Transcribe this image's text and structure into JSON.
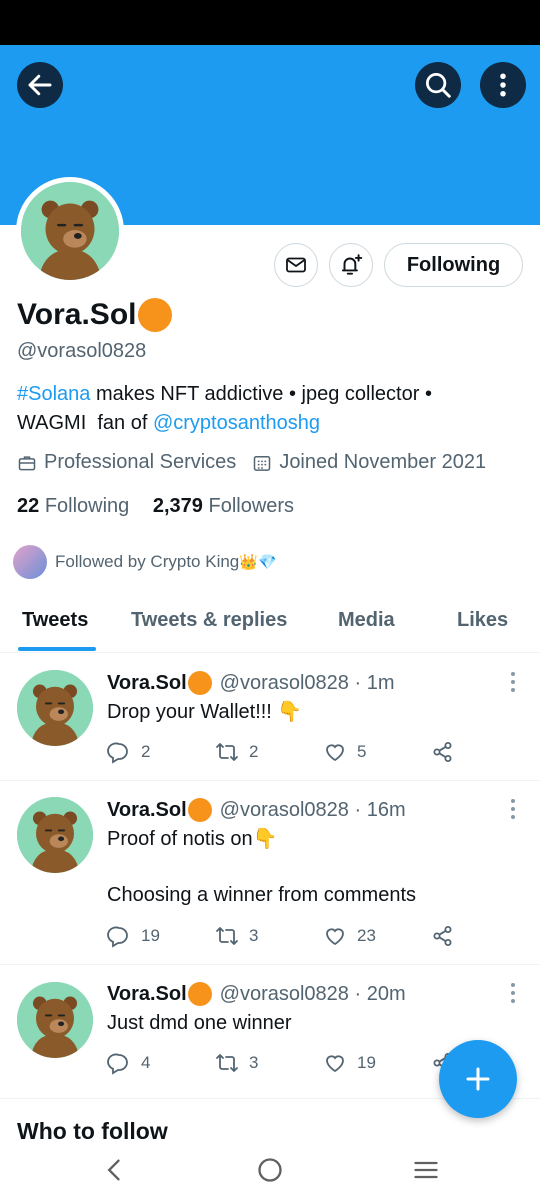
{
  "banner": {
    "color": "#1d9bf0"
  },
  "profile": {
    "display_name": "Vora.Sol",
    "handle": "@vorasol0828",
    "bio_hashtag": "#Solana",
    "bio_text_1": " makes NFT addictive • jpeg collector •",
    "bio_text_2": "WAGMI  fan of ",
    "bio_mention": "@cryptosanthoshg",
    "category": "Professional Services",
    "joined": "Joined November 2021",
    "following_count": "22",
    "following_label": "Following",
    "followers_count": "2,379",
    "followers_label": "Followers",
    "followed_by": "Followed by Crypto King",
    "followed_by_emoji": "👑💎"
  },
  "actions": {
    "follow_button": "Following"
  },
  "tabs": [
    {
      "label": "Tweets",
      "active": true
    },
    {
      "label": "Tweets & replies",
      "active": false
    },
    {
      "label": "Media",
      "active": false
    },
    {
      "label": "Likes",
      "active": false
    }
  ],
  "tweets": [
    {
      "name": "Vora.Sol",
      "handle": "@vorasol0828",
      "time": "· 1m",
      "text": "Drop your Wallet!!! 👇",
      "replies": "2",
      "retweets": "2",
      "likes": "5"
    },
    {
      "name": "Vora.Sol",
      "handle": "@vorasol0828",
      "time": "· 16m",
      "text": "Proof of notis on👇\n\nChoosing a winner from comments",
      "replies": "19",
      "retweets": "3",
      "likes": "23"
    },
    {
      "name": "Vora.Sol",
      "handle": "@vorasol0828",
      "time": "· 20m",
      "text": "Just dmd one winner",
      "replies": "4",
      "retweets": "3",
      "likes": "19"
    }
  ],
  "section": {
    "who_to_follow": "Who to follow"
  },
  "icons": [
    "back-arrow-icon",
    "search-icon",
    "more-vertical-icon",
    "mail-icon",
    "bell-plus-icon",
    "briefcase-icon",
    "calendar-icon",
    "reply-icon",
    "retweet-icon",
    "heart-icon",
    "share-icon",
    "plus-icon"
  ]
}
